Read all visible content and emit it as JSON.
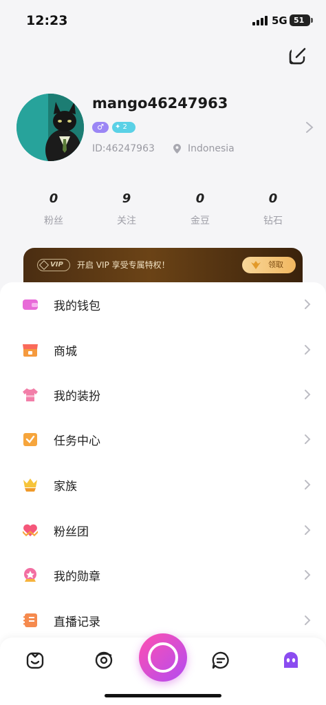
{
  "status_bar": {
    "time": "12:23",
    "network": "5G",
    "battery": "51"
  },
  "profile": {
    "username": "mango46247963",
    "gender_symbol": "♂",
    "level_badge": "✦ 2",
    "id_text": "ID:46247963",
    "location": "Indonesia"
  },
  "stats": [
    {
      "value": "0",
      "label": "粉丝"
    },
    {
      "value": "9",
      "label": "关注"
    },
    {
      "value": "0",
      "label": "金豆"
    },
    {
      "value": "0",
      "label": "钻石"
    }
  ],
  "vip": {
    "tag": "VIP",
    "text": "开启 VIP 享受专属特权！",
    "button": "领取"
  },
  "menu": [
    {
      "label": "我的钱包",
      "icon": "wallet-icon"
    },
    {
      "label": "商城",
      "icon": "store-icon"
    },
    {
      "label": "我的装扮",
      "icon": "outfit-icon"
    },
    {
      "label": "任务中心",
      "icon": "task-icon"
    },
    {
      "label": "家族",
      "icon": "family-icon"
    },
    {
      "label": "粉丝团",
      "icon": "fan-club-icon"
    },
    {
      "label": "我的勋章",
      "icon": "medal-icon"
    },
    {
      "label": "直播记录",
      "icon": "live-record-icon"
    }
  ],
  "tabs": [
    "home-tab",
    "discover-tab",
    "live-tab",
    "messages-tab",
    "profile-tab"
  ],
  "colors": {
    "accent_pink": "#ff4fb0",
    "accent_purple": "#b24cf2",
    "vip_gold": "#f1b760"
  }
}
